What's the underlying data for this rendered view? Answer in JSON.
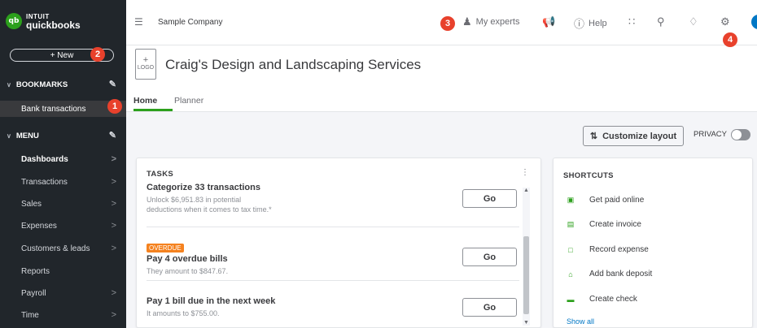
{
  "brand": {
    "logo_mark": "qb",
    "line1": "INTUIT",
    "line2": "quickbooks"
  },
  "sidebar": {
    "new_label": "+ New",
    "bookmarks_label": "BOOKMARKS",
    "bookmarks": [
      {
        "label": "Bank transactions"
      }
    ],
    "menu_label": "MENU",
    "items": [
      {
        "label": "Dashboards",
        "arrow": ">"
      },
      {
        "label": "Transactions",
        "arrow": ">"
      },
      {
        "label": "Sales",
        "arrow": ">"
      },
      {
        "label": "Expenses",
        "arrow": ">"
      },
      {
        "label": "Customers & leads",
        "arrow": ">"
      },
      {
        "label": "Reports",
        "arrow": ""
      },
      {
        "label": "Payroll",
        "arrow": ">"
      },
      {
        "label": "Time",
        "arrow": ">"
      }
    ]
  },
  "topbar": {
    "company": "Sample Company",
    "my_experts": "My experts",
    "help": "Help"
  },
  "badges": {
    "b1": "1",
    "b2": "2",
    "b3": "3",
    "b4": "4"
  },
  "header": {
    "logo_plus": "+",
    "logo_text": "LOGO",
    "company_title": "Craig's Design and Landscaping Services"
  },
  "tabs": [
    {
      "label": "Home"
    },
    {
      "label": "Planner"
    }
  ],
  "toolbar": {
    "customize_label": "Customize layout",
    "privacy_label": "PRIVACY"
  },
  "tasks": {
    "heading": "TASKS",
    "items": [
      {
        "title": "Categorize 33 transactions",
        "desc1": "Unlock $6,951.83 in potential",
        "desc2": "deductions when it comes to tax time.*",
        "button": "Go"
      },
      {
        "tag": "OVERDUE",
        "title": "Pay 4 overdue bills",
        "desc1": "They amount to $847.67.",
        "button": "Go"
      },
      {
        "title": "Pay 1 bill due in the next week",
        "desc1": "It amounts to $755.00.",
        "button": "Go"
      }
    ]
  },
  "shortcuts": {
    "heading": "SHORTCUTS",
    "items": [
      {
        "label": "Get paid online"
      },
      {
        "label": "Create invoice"
      },
      {
        "label": "Record expense"
      },
      {
        "label": "Add bank deposit"
      },
      {
        "label": "Create check"
      }
    ],
    "show_all": "Show all"
  },
  "colors": {
    "brand_green": "#2ca01c",
    "sidebar_bg": "#21262b",
    "badge_red": "#e8412c",
    "overdue_orange": "#f5821f",
    "link_blue": "#0077c5"
  }
}
